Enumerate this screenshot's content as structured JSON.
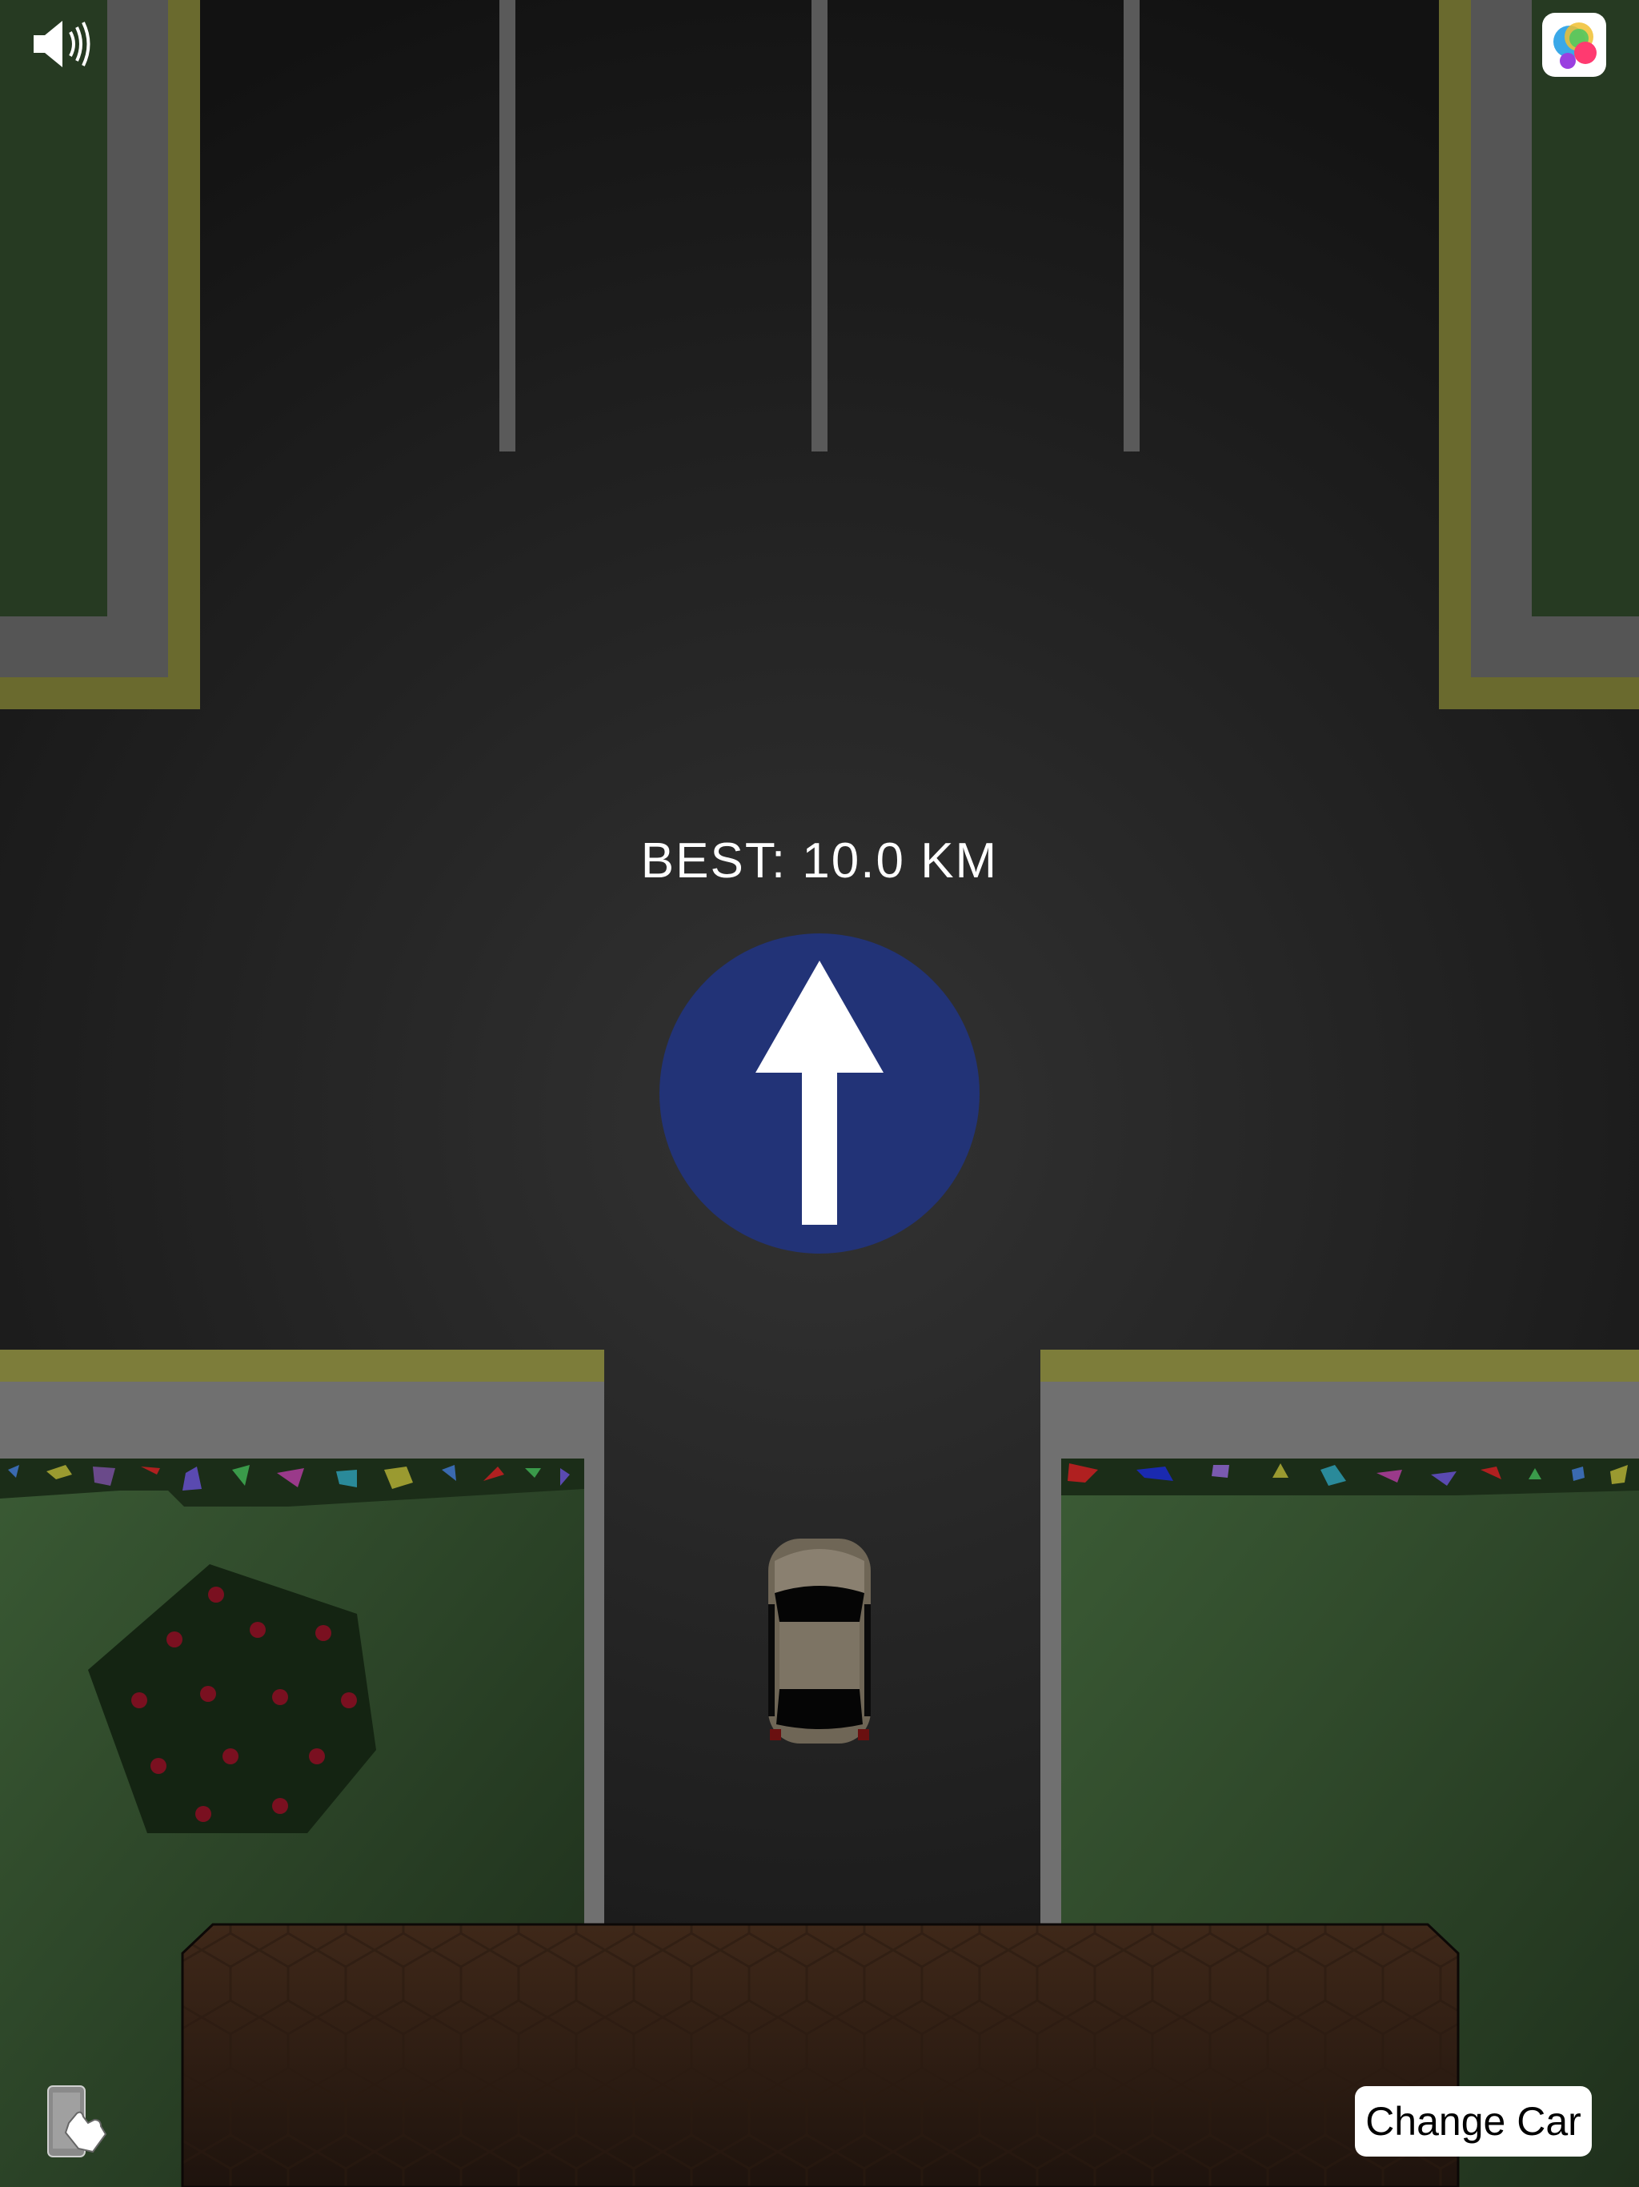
{
  "hud": {
    "best_label": "BEST: 10.0 KM",
    "change_car_label": "Change Car"
  },
  "icons": {
    "sound": "speaker-with-waves-icon",
    "game_center": "game-center-bubbles-icon",
    "tilt_control": "phone-tap-hand-icon",
    "direction_sign": "straight-ahead-arrow-sign"
  },
  "colors": {
    "road": "#1f1f1f",
    "curb": "#6a6a6a",
    "curb_edge": "#7a7a30",
    "grass": "#2f4a2b",
    "sign_blue": "#223377",
    "car_body": "#7a6f60",
    "barrier": "#3a2418"
  }
}
